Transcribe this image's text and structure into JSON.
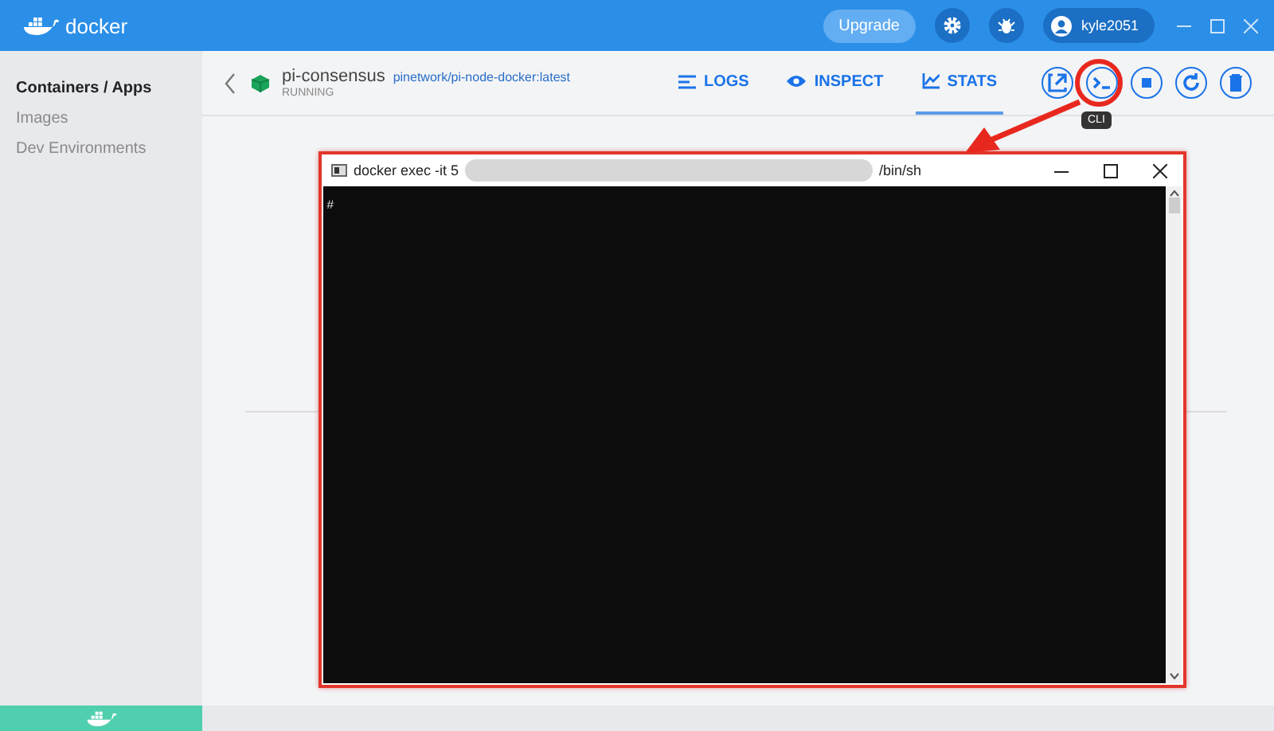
{
  "header": {
    "logo": "docker",
    "upgrade": "Upgrade",
    "user": "kyle2051"
  },
  "sidebar": {
    "items": [
      {
        "label": "Containers / Apps",
        "selected": true
      },
      {
        "label": "Images",
        "selected": false
      },
      {
        "label": "Dev Environments",
        "selected": false
      }
    ]
  },
  "container": {
    "name": "pi-consensus",
    "image": "pinetwork/pi-node-docker:latest",
    "status": "RUNNING"
  },
  "tabs": [
    {
      "label": "LOGS",
      "kind": "logs",
      "selected": false
    },
    {
      "label": "INSPECT",
      "kind": "inspect",
      "selected": false
    },
    {
      "label": "STATS",
      "kind": "stats",
      "selected": true
    }
  ],
  "actions": [
    {
      "kind": "open",
      "highlighted": false
    },
    {
      "kind": "cli",
      "highlighted": true,
      "tooltip": "CLI"
    },
    {
      "kind": "stop",
      "highlighted": false
    },
    {
      "kind": "restart",
      "highlighted": false
    },
    {
      "kind": "delete",
      "highlighted": false
    }
  ],
  "terminal": {
    "title_start": "docker exec -it 5",
    "title_end": "/bin/sh",
    "prompt": "#"
  }
}
